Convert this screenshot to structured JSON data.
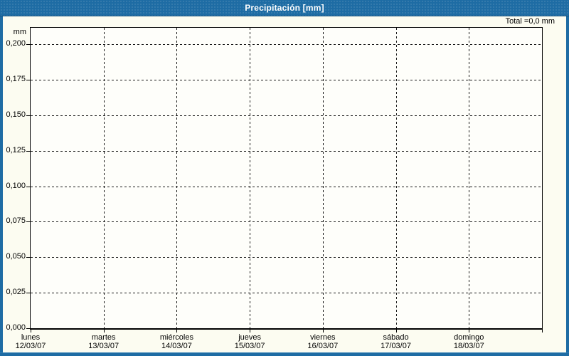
{
  "window": {
    "title": "Precipitación [mm]",
    "total_label": "Total =0,0 mm",
    "accent_color": "#1e6ca4"
  },
  "chart_data": {
    "type": "bar",
    "title": "Precipitación [mm]",
    "xlabel": "",
    "ylabel": "mm",
    "ylim": [
      0,
      0.2115
    ],
    "grid": {
      "style": "dashed",
      "color": "#000000"
    },
    "legend": "none",
    "decimal_separator": ",",
    "y_ticks": [
      {
        "value": 0.0,
        "label": "0,000"
      },
      {
        "value": 0.025,
        "label": "0,025"
      },
      {
        "value": 0.05,
        "label": "0,050"
      },
      {
        "value": 0.075,
        "label": "0,075"
      },
      {
        "value": 0.1,
        "label": "0,100"
      },
      {
        "value": 0.125,
        "label": "0,125"
      },
      {
        "value": 0.15,
        "label": "0,150"
      },
      {
        "value": 0.175,
        "label": "0,175"
      },
      {
        "value": 0.2,
        "label": "0,200"
      }
    ],
    "categories": [
      {
        "day": "lunes",
        "date": "12/03/07"
      },
      {
        "day": "martes",
        "date": "13/03/07"
      },
      {
        "day": "miércoles",
        "date": "14/03/07"
      },
      {
        "day": "jueves",
        "date": "15/03/07"
      },
      {
        "day": "viernes",
        "date": "16/03/07"
      },
      {
        "day": "sábado",
        "date": "17/03/07"
      },
      {
        "day": "domingo",
        "date": "18/03/07"
      }
    ],
    "series": [
      {
        "name": "Precipitación",
        "values": [
          0,
          0,
          0,
          0,
          0,
          0,
          0
        ]
      }
    ],
    "total_text": "Total =0,0 mm",
    "total_mm": "0,0"
  }
}
